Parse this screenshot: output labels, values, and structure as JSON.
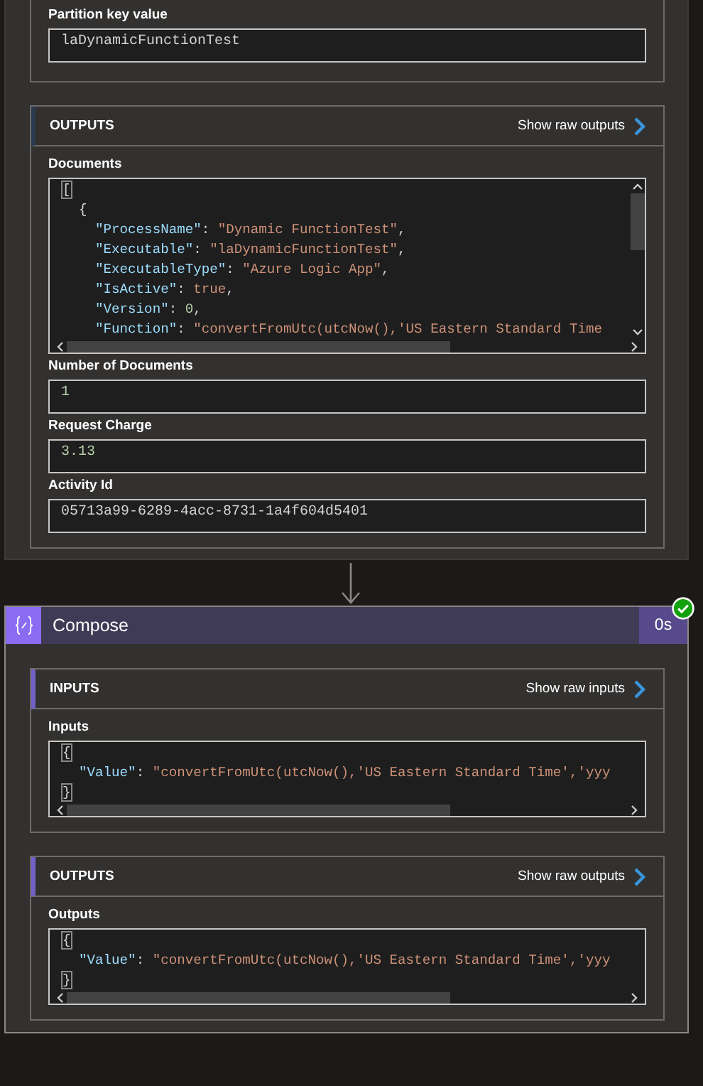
{
  "cards": [
    {
      "kind": "action",
      "sections": [
        {
          "fields": [
            {
              "label": "Partition key value",
              "kind": "text",
              "value": "laDynamicFunctionTest"
            }
          ]
        },
        {
          "title": "OUTPUTS",
          "link": "Show raw outputs",
          "fields": [
            {
              "label": "Documents",
              "kind": "code",
              "vscroll": true,
              "lines": [
                {
                  "tokens": [
                    {
                      "kind": "match",
                      "text": "["
                    }
                  ],
                  "children": [
                    {
                      "tokens": [
                        {
                          "kind": "punct",
                          "text": "{"
                        }
                      ],
                      "children": [
                        {
                          "tokens": [
                            {
                              "kind": "key",
                              "text": "\"ProcessName\""
                            },
                            {
                              "kind": "punct",
                              "text": ": "
                            },
                            {
                              "kind": "string",
                              "text": "\"Dynamic FunctionTest\""
                            },
                            {
                              "kind": "punct",
                              "text": ","
                            }
                          ]
                        },
                        {
                          "tokens": [
                            {
                              "kind": "key",
                              "text": "\"Executable\""
                            },
                            {
                              "kind": "punct",
                              "text": ": "
                            },
                            {
                              "kind": "string",
                              "text": "\"laDynamicFunctionTest\""
                            },
                            {
                              "kind": "punct",
                              "text": ","
                            }
                          ]
                        },
                        {
                          "tokens": [
                            {
                              "kind": "key",
                              "text": "\"ExecutableType\""
                            },
                            {
                              "kind": "punct",
                              "text": ": "
                            },
                            {
                              "kind": "string",
                              "text": "\"Azure Logic App\""
                            },
                            {
                              "kind": "punct",
                              "text": ","
                            }
                          ]
                        },
                        {
                          "tokens": [
                            {
                              "kind": "key",
                              "text": "\"IsActive\""
                            },
                            {
                              "kind": "punct",
                              "text": ": "
                            },
                            {
                              "kind": "string",
                              "text": "true"
                            },
                            {
                              "kind": "punct",
                              "text": ","
                            }
                          ]
                        },
                        {
                          "tokens": [
                            {
                              "kind": "key",
                              "text": "\"Version\""
                            },
                            {
                              "kind": "punct",
                              "text": ": "
                            },
                            {
                              "kind": "number",
                              "text": "0"
                            },
                            {
                              "kind": "punct",
                              "text": ","
                            }
                          ]
                        },
                        {
                          "tokens": [
                            {
                              "kind": "key",
                              "text": "\"Function\""
                            },
                            {
                              "kind": "punct",
                              "text": ": "
                            },
                            {
                              "kind": "string",
                              "text": "\"convertFromUtc(utcNow(),'US Eastern Standard Time"
                            }
                          ]
                        }
                      ]
                    }
                  ]
                }
              ]
            },
            {
              "label": "Number of Documents",
              "kind": "number",
              "value": "1"
            },
            {
              "label": "Request Charge",
              "kind": "number",
              "value": "3.13"
            },
            {
              "label": "Activity Id",
              "kind": "text",
              "value": "05713a99-6289-4acc-8731-1a4f604d5401"
            }
          ]
        }
      ]
    },
    {
      "kind": "compose",
      "title": "Compose",
      "duration": "0s",
      "sections": [
        {
          "title": "INPUTS",
          "link": "Show raw inputs",
          "fields": [
            {
              "label": "Inputs",
              "kind": "code",
              "vscroll": false,
              "lines": [
                {
                  "tokens": [
                    {
                      "kind": "match",
                      "text": "{"
                    }
                  ],
                  "children": [
                    {
                      "tokens": [
                        {
                          "kind": "key",
                          "text": "\"Value\""
                        },
                        {
                          "kind": "punct",
                          "text": ": "
                        },
                        {
                          "kind": "string",
                          "text": "\"convertFromUtc(utcNow(),'US Eastern Standard Time','yyy"
                        }
                      ]
                    }
                  ]
                },
                {
                  "tokens": [
                    {
                      "kind": "match",
                      "text": "}"
                    }
                  ]
                }
              ]
            }
          ]
        },
        {
          "title": "OUTPUTS",
          "link": "Show raw outputs",
          "fields": [
            {
              "label": "Outputs",
              "kind": "code",
              "vscroll": false,
              "lines": [
                {
                  "tokens": [
                    {
                      "kind": "match",
                      "text": "{"
                    }
                  ],
                  "children": [
                    {
                      "tokens": [
                        {
                          "kind": "key",
                          "text": "\"Value\""
                        },
                        {
                          "kind": "punct",
                          "text": ": "
                        },
                        {
                          "kind": "string",
                          "text": "\"convertFromUtc(utcNow(),'US Eastern Standard Time','yyy"
                        }
                      ]
                    }
                  ]
                },
                {
                  "tokens": [
                    {
                      "kind": "match",
                      "text": "}"
                    }
                  ]
                }
              ]
            }
          ]
        }
      ]
    }
  ]
}
